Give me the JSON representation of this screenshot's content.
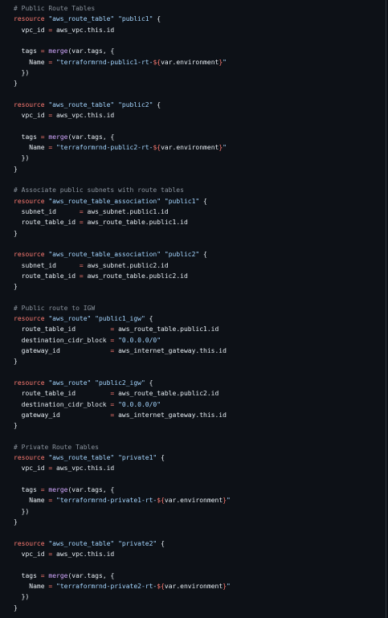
{
  "editor": {
    "background": "#0d1117",
    "colors": {
      "comment": "#8b949e",
      "keyword": "#ff7b72",
      "string": "#a5d6ff",
      "function": "#d2a8ff",
      "text": "#e6edf3"
    },
    "lines": [
      [
        {
          "t": "cm",
          "v": "# Public Route Tables"
        }
      ],
      [
        {
          "t": "kw",
          "v": "resource"
        },
        {
          "t": "tx",
          "v": " "
        },
        {
          "t": "st",
          "v": "\"aws_route_table\""
        },
        {
          "t": "tx",
          "v": " "
        },
        {
          "t": "st",
          "v": "\"public1\""
        },
        {
          "t": "tx",
          "v": " {"
        }
      ],
      [
        {
          "t": "tx",
          "v": "  vpc_id "
        },
        {
          "t": "op",
          "v": "="
        },
        {
          "t": "tx",
          "v": " aws_vpc.this.id"
        }
      ],
      [],
      [
        {
          "t": "tx",
          "v": "  tags "
        },
        {
          "t": "op",
          "v": "="
        },
        {
          "t": "tx",
          "v": " "
        },
        {
          "t": "fn",
          "v": "merge"
        },
        {
          "t": "tx",
          "v": "(var.tags, {"
        }
      ],
      [
        {
          "t": "tx",
          "v": "    Name "
        },
        {
          "t": "op",
          "v": "="
        },
        {
          "t": "tx",
          "v": " "
        },
        {
          "t": "st",
          "v": "\"terraformrnd-public1-rt-"
        },
        {
          "t": "op",
          "v": "${"
        },
        {
          "t": "tx",
          "v": "var.environment"
        },
        {
          "t": "op",
          "v": "}"
        },
        {
          "t": "st",
          "v": "\""
        }
      ],
      [
        {
          "t": "tx",
          "v": "  })"
        }
      ],
      [
        {
          "t": "tx",
          "v": "}"
        }
      ],
      [],
      [
        {
          "t": "kw",
          "v": "resource"
        },
        {
          "t": "tx",
          "v": " "
        },
        {
          "t": "st",
          "v": "\"aws_route_table\""
        },
        {
          "t": "tx",
          "v": " "
        },
        {
          "t": "st",
          "v": "\"public2\""
        },
        {
          "t": "tx",
          "v": " {"
        }
      ],
      [
        {
          "t": "tx",
          "v": "  vpc_id "
        },
        {
          "t": "op",
          "v": "="
        },
        {
          "t": "tx",
          "v": " aws_vpc.this.id"
        }
      ],
      [],
      [
        {
          "t": "tx",
          "v": "  tags "
        },
        {
          "t": "op",
          "v": "="
        },
        {
          "t": "tx",
          "v": " "
        },
        {
          "t": "fn",
          "v": "merge"
        },
        {
          "t": "tx",
          "v": "(var.tags, {"
        }
      ],
      [
        {
          "t": "tx",
          "v": "    Name "
        },
        {
          "t": "op",
          "v": "="
        },
        {
          "t": "tx",
          "v": " "
        },
        {
          "t": "st",
          "v": "\"terraformrnd-public2-rt-"
        },
        {
          "t": "op",
          "v": "${"
        },
        {
          "t": "tx",
          "v": "var.environment"
        },
        {
          "t": "op",
          "v": "}"
        },
        {
          "t": "st",
          "v": "\""
        }
      ],
      [
        {
          "t": "tx",
          "v": "  })"
        }
      ],
      [
        {
          "t": "tx",
          "v": "}"
        }
      ],
      [],
      [
        {
          "t": "cm",
          "v": "# Associate public subnets with route tables"
        }
      ],
      [
        {
          "t": "kw",
          "v": "resource"
        },
        {
          "t": "tx",
          "v": " "
        },
        {
          "t": "st",
          "v": "\"aws_route_table_association\""
        },
        {
          "t": "tx",
          "v": " "
        },
        {
          "t": "st",
          "v": "\"public1\""
        },
        {
          "t": "tx",
          "v": " {"
        }
      ],
      [
        {
          "t": "tx",
          "v": "  subnet_id      "
        },
        {
          "t": "op",
          "v": "="
        },
        {
          "t": "tx",
          "v": " aws_subnet.public1.id"
        }
      ],
      [
        {
          "t": "tx",
          "v": "  route_table_id "
        },
        {
          "t": "op",
          "v": "="
        },
        {
          "t": "tx",
          "v": " aws_route_table.public1.id"
        }
      ],
      [
        {
          "t": "tx",
          "v": "}"
        }
      ],
      [],
      [
        {
          "t": "kw",
          "v": "resource"
        },
        {
          "t": "tx",
          "v": " "
        },
        {
          "t": "st",
          "v": "\"aws_route_table_association\""
        },
        {
          "t": "tx",
          "v": " "
        },
        {
          "t": "st",
          "v": "\"public2\""
        },
        {
          "t": "tx",
          "v": " {"
        }
      ],
      [
        {
          "t": "tx",
          "v": "  subnet_id      "
        },
        {
          "t": "op",
          "v": "="
        },
        {
          "t": "tx",
          "v": " aws_subnet.public2.id"
        }
      ],
      [
        {
          "t": "tx",
          "v": "  route_table_id "
        },
        {
          "t": "op",
          "v": "="
        },
        {
          "t": "tx",
          "v": " aws_route_table.public2.id"
        }
      ],
      [
        {
          "t": "tx",
          "v": "}"
        }
      ],
      [],
      [
        {
          "t": "cm",
          "v": "# Public route to IGW"
        }
      ],
      [
        {
          "t": "kw",
          "v": "resource"
        },
        {
          "t": "tx",
          "v": " "
        },
        {
          "t": "st",
          "v": "\"aws_route\""
        },
        {
          "t": "tx",
          "v": " "
        },
        {
          "t": "st",
          "v": "\"public1_igw\""
        },
        {
          "t": "tx",
          "v": " {"
        }
      ],
      [
        {
          "t": "tx",
          "v": "  route_table_id         "
        },
        {
          "t": "op",
          "v": "="
        },
        {
          "t": "tx",
          "v": " aws_route_table.public1.id"
        }
      ],
      [
        {
          "t": "tx",
          "v": "  destination_cidr_block "
        },
        {
          "t": "op",
          "v": "="
        },
        {
          "t": "tx",
          "v": " "
        },
        {
          "t": "st",
          "v": "\"0.0.0.0/0\""
        }
      ],
      [
        {
          "t": "tx",
          "v": "  gateway_id             "
        },
        {
          "t": "op",
          "v": "="
        },
        {
          "t": "tx",
          "v": " aws_internet_gateway.this.id"
        }
      ],
      [
        {
          "t": "tx",
          "v": "}"
        }
      ],
      [],
      [
        {
          "t": "kw",
          "v": "resource"
        },
        {
          "t": "tx",
          "v": " "
        },
        {
          "t": "st",
          "v": "\"aws_route\""
        },
        {
          "t": "tx",
          "v": " "
        },
        {
          "t": "st",
          "v": "\"public2_igw\""
        },
        {
          "t": "tx",
          "v": " {"
        }
      ],
      [
        {
          "t": "tx",
          "v": "  route_table_id         "
        },
        {
          "t": "op",
          "v": "="
        },
        {
          "t": "tx",
          "v": " aws_route_table.public2.id"
        }
      ],
      [
        {
          "t": "tx",
          "v": "  destination_cidr_block "
        },
        {
          "t": "op",
          "v": "="
        },
        {
          "t": "tx",
          "v": " "
        },
        {
          "t": "st",
          "v": "\"0.0.0.0/0\""
        }
      ],
      [
        {
          "t": "tx",
          "v": "  gateway_id             "
        },
        {
          "t": "op",
          "v": "="
        },
        {
          "t": "tx",
          "v": " aws_internet_gateway.this.id"
        }
      ],
      [
        {
          "t": "tx",
          "v": "}"
        }
      ],
      [],
      [
        {
          "t": "cm",
          "v": "# Private Route Tables"
        }
      ],
      [
        {
          "t": "kw",
          "v": "resource"
        },
        {
          "t": "tx",
          "v": " "
        },
        {
          "t": "st",
          "v": "\"aws_route_table\""
        },
        {
          "t": "tx",
          "v": " "
        },
        {
          "t": "st",
          "v": "\"private1\""
        },
        {
          "t": "tx",
          "v": " {"
        }
      ],
      [
        {
          "t": "tx",
          "v": "  vpc_id "
        },
        {
          "t": "op",
          "v": "="
        },
        {
          "t": "tx",
          "v": " aws_vpc.this.id"
        }
      ],
      [],
      [
        {
          "t": "tx",
          "v": "  tags "
        },
        {
          "t": "op",
          "v": "="
        },
        {
          "t": "tx",
          "v": " "
        },
        {
          "t": "fn",
          "v": "merge"
        },
        {
          "t": "tx",
          "v": "(var.tags, {"
        }
      ],
      [
        {
          "t": "tx",
          "v": "    Name "
        },
        {
          "t": "op",
          "v": "="
        },
        {
          "t": "tx",
          "v": " "
        },
        {
          "t": "st",
          "v": "\"terraformrnd-private1-rt-"
        },
        {
          "t": "op",
          "v": "${"
        },
        {
          "t": "tx",
          "v": "var.environment"
        },
        {
          "t": "op",
          "v": "}"
        },
        {
          "t": "st",
          "v": "\""
        }
      ],
      [
        {
          "t": "tx",
          "v": "  })"
        }
      ],
      [
        {
          "t": "tx",
          "v": "}"
        }
      ],
      [],
      [
        {
          "t": "kw",
          "v": "resource"
        },
        {
          "t": "tx",
          "v": " "
        },
        {
          "t": "st",
          "v": "\"aws_route_table\""
        },
        {
          "t": "tx",
          "v": " "
        },
        {
          "t": "st",
          "v": "\"private2\""
        },
        {
          "t": "tx",
          "v": " {"
        }
      ],
      [
        {
          "t": "tx",
          "v": "  vpc_id "
        },
        {
          "t": "op",
          "v": "="
        },
        {
          "t": "tx",
          "v": " aws_vpc.this.id"
        }
      ],
      [],
      [
        {
          "t": "tx",
          "v": "  tags "
        },
        {
          "t": "op",
          "v": "="
        },
        {
          "t": "tx",
          "v": " "
        },
        {
          "t": "fn",
          "v": "merge"
        },
        {
          "t": "tx",
          "v": "(var.tags, {"
        }
      ],
      [
        {
          "t": "tx",
          "v": "    Name "
        },
        {
          "t": "op",
          "v": "="
        },
        {
          "t": "tx",
          "v": " "
        },
        {
          "t": "st",
          "v": "\"terraformrnd-private2-rt-"
        },
        {
          "t": "op",
          "v": "${"
        },
        {
          "t": "tx",
          "v": "var.environment"
        },
        {
          "t": "op",
          "v": "}"
        },
        {
          "t": "st",
          "v": "\""
        }
      ],
      [
        {
          "t": "tx",
          "v": "  })"
        }
      ],
      [
        {
          "t": "tx",
          "v": "}"
        }
      ]
    ]
  }
}
